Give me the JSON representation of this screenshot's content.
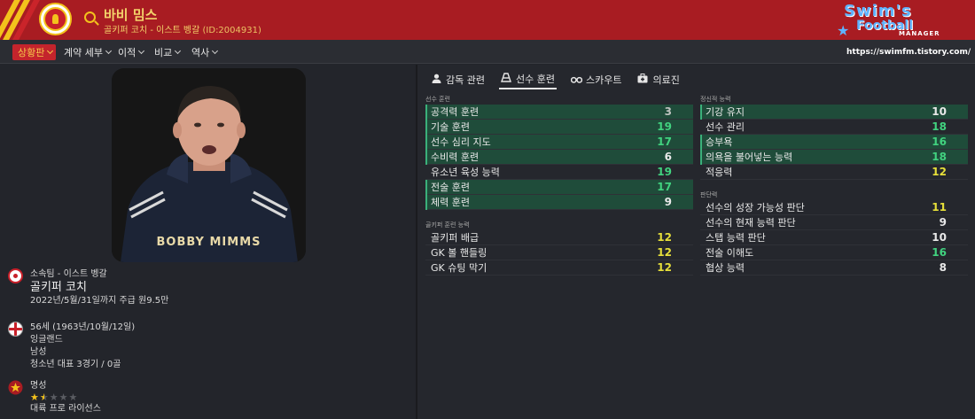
{
  "header": {
    "name": "바비 밈스",
    "role": "골키퍼 코치 - 이스트 벵갈",
    "id_text": "(ID:2004931)"
  },
  "watermark": {
    "line1": "Swim's",
    "line2": "Football",
    "line3": "MANAGER",
    "url": "https://swimfm.tistory.com/"
  },
  "nav": {
    "items": [
      {
        "label": "상황판",
        "active": true
      },
      {
        "label": "계약 세부",
        "active": false
      },
      {
        "label": "이적",
        "active": false
      },
      {
        "label": "비교",
        "active": false
      },
      {
        "label": "역사",
        "active": false
      }
    ]
  },
  "profile": {
    "shirt_text": "BOBBY MIMMS",
    "club_line": "소속팀 - 이스트 벵갈",
    "job": "골키퍼 코치",
    "contract": "2022년/5월/31일까지 주급 원9.5만",
    "age": "56세 (1963년/10월/12일)",
    "nation": "잉글랜드",
    "gender": "남성",
    "caps": "청소년 대표 3경기 / 0골",
    "reputation_label": "명성",
    "reputation_stars": 1.5,
    "reputation_max": 5,
    "license": "대륙 프로 라이선스"
  },
  "tabs": [
    {
      "label": "감독 관련",
      "icon": "user-icon",
      "active": false
    },
    {
      "label": "선수 훈련",
      "icon": "training-cone-icon",
      "active": true
    },
    {
      "label": "스카우트",
      "icon": "binoculars-icon",
      "active": false
    },
    {
      "label": "의료진",
      "icon": "medical-kit-icon",
      "active": false
    }
  ],
  "sections": {
    "player_training": {
      "title": "선수 훈련",
      "rows": [
        {
          "label": "공격력 훈련",
          "value": "3",
          "hl": true,
          "color": "grey"
        },
        {
          "label": "기술 훈련",
          "value": "19",
          "hl": true,
          "color": "green"
        },
        {
          "label": "선수 심리 지도",
          "value": "17",
          "hl": true,
          "color": "green"
        },
        {
          "label": "수비력 훈련",
          "value": "6",
          "hl": true,
          "color": "white"
        },
        {
          "label": "유소년 육성 능력",
          "value": "19",
          "hl": false,
          "color": "green"
        },
        {
          "label": "전술 훈련",
          "value": "17",
          "hl": true,
          "color": "green"
        },
        {
          "label": "체력 훈련",
          "value": "9",
          "hl": true,
          "color": "white"
        }
      ]
    },
    "gk_training": {
      "title": "골키퍼 훈련 능력",
      "rows": [
        {
          "label": "골키퍼 배급",
          "value": "12",
          "hl": false,
          "color": "yellow"
        },
        {
          "label": "GK 볼 핸들링",
          "value": "12",
          "hl": false,
          "color": "yellow"
        },
        {
          "label": "GK 슈팅 막기",
          "value": "12",
          "hl": false,
          "color": "yellow"
        }
      ]
    },
    "mental": {
      "title": "정신적 능력",
      "rows": [
        {
          "label": "기강 유지",
          "value": "10",
          "hl": true,
          "color": "white"
        },
        {
          "label": "선수 관리",
          "value": "18",
          "hl": false,
          "color": "green"
        },
        {
          "label": "승부욕",
          "value": "16",
          "hl": true,
          "color": "green"
        },
        {
          "label": "의욕을 불어넣는 능력",
          "value": "18",
          "hl": true,
          "color": "green"
        },
        {
          "label": "적응력",
          "value": "12",
          "hl": false,
          "color": "yellow"
        }
      ]
    },
    "judgement": {
      "title": "판단력",
      "rows": [
        {
          "label": "선수의 성장 가능성 판단",
          "value": "11",
          "hl": false,
          "color": "yellow"
        },
        {
          "label": "선수의 현재 능력 판단",
          "value": "9",
          "hl": false,
          "color": "white"
        },
        {
          "label": "스탭 능력 판단",
          "value": "10",
          "hl": false,
          "color": "white"
        },
        {
          "label": "전술 이해도",
          "value": "16",
          "hl": false,
          "color": "green"
        },
        {
          "label": "협상 능력",
          "value": "8",
          "hl": false,
          "color": "white"
        }
      ]
    }
  },
  "colors": {
    "header_red": "#a81c22",
    "accent_yellow": "#f3c21c",
    "highlight_green": "#1f4c3a",
    "value_green": "#41d27f",
    "value_yellow": "#e6df3a"
  }
}
